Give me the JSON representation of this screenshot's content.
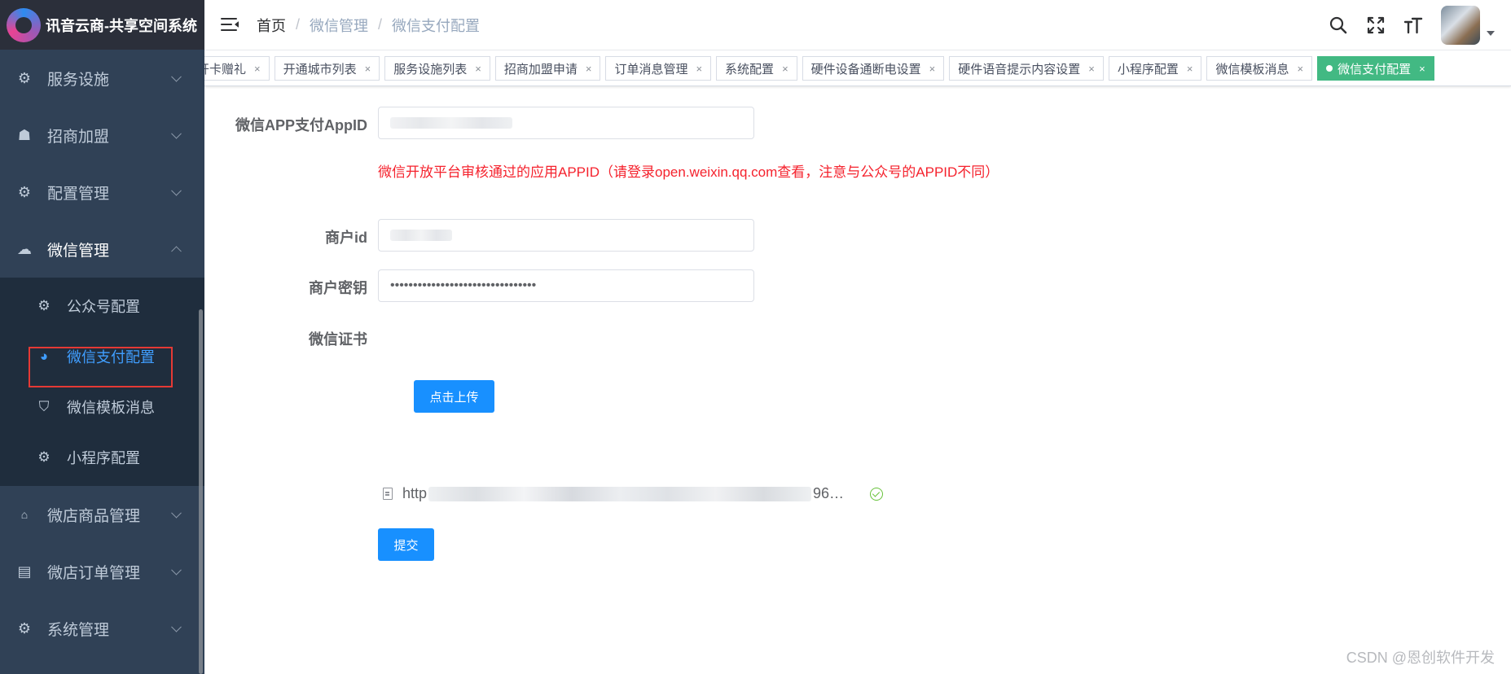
{
  "app": {
    "title": "讯音云商-共享空间系统"
  },
  "sidebar": {
    "items": [
      {
        "label": "服务设施",
        "icon": "gear-icon"
      },
      {
        "label": "招商加盟",
        "icon": "user-icon"
      },
      {
        "label": "配置管理",
        "icon": "gear-icon"
      },
      {
        "label": "微信管理",
        "icon": "wechat-icon"
      },
      {
        "label": "微店商品管理",
        "icon": "shop-icon"
      },
      {
        "label": "微店订单管理",
        "icon": "order-icon"
      },
      {
        "label": "系统管理",
        "icon": "gear-icon"
      }
    ],
    "submenu": [
      {
        "label": "公众号配置",
        "icon": "gear-icon"
      },
      {
        "label": "微信支付配置",
        "icon": "pay-icon"
      },
      {
        "label": "微信模板消息",
        "icon": "shield-icon"
      },
      {
        "label": "小程序配置",
        "icon": "gear-icon"
      }
    ]
  },
  "breadcrumb": {
    "home": "首页",
    "sep": "/",
    "level1": "微信管理",
    "level2": "微信支付配置"
  },
  "tags": [
    "开卡赠礼",
    "开通城市列表",
    "服务设施列表",
    "招商加盟申请",
    "订单消息管理",
    "系统配置",
    "硬件设备通断电设置",
    "硬件语音提示内容设置",
    "小程序配置",
    "微信模板消息",
    "微信支付配置"
  ],
  "tag_close": "×",
  "form": {
    "appid_label": "微信APP支付AppID",
    "appid_hint": "微信开放平台审核通过的应用APPID（请登录open.weixin.qq.com查看，注意与公众号的APPID不同）",
    "mchid_label": "商户id",
    "key_label": "商户密钥",
    "key_value": "••••••••••••••••••••••••••••••••",
    "cert_label": "微信证书",
    "upload_button": "点击上传",
    "file_prefix": "http",
    "file_suffix": "96…",
    "submit_button": "提交"
  },
  "watermark": "CSDN @恩创软件开发",
  "colors": {
    "sidebar": "#304156",
    "active": "#409eff",
    "tag_active": "#42b983",
    "hint": "#f5222d",
    "primary_button": "#1890ff"
  }
}
